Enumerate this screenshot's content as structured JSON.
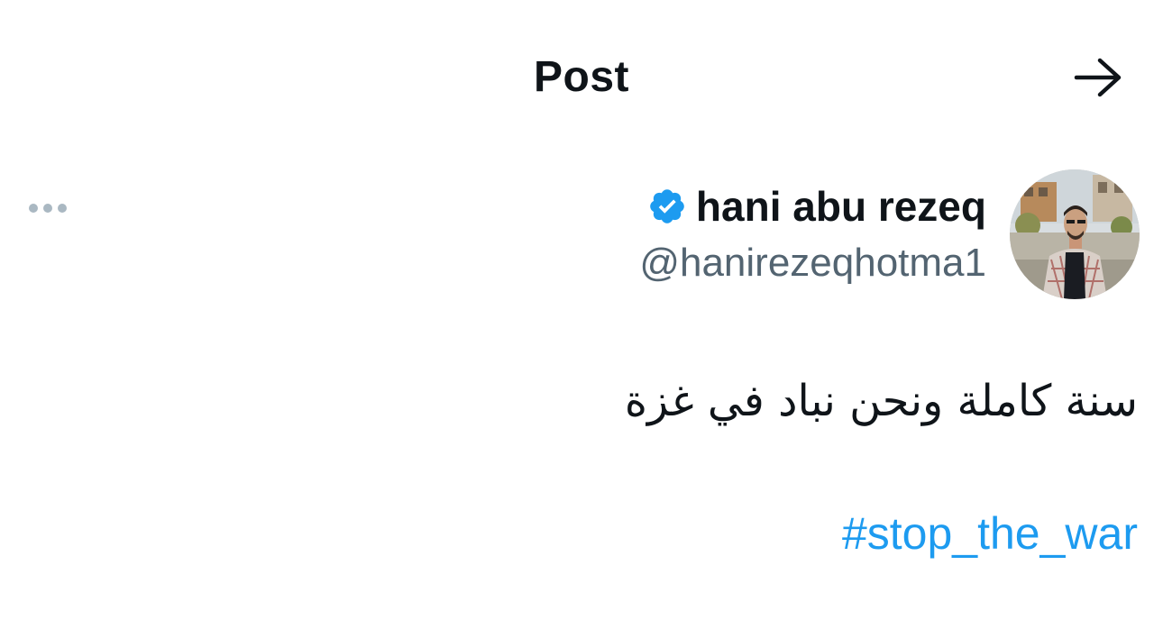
{
  "header": {
    "title": "Post",
    "back_icon": "arrow-right-icon"
  },
  "author": {
    "display_name": "hani abu rezeq",
    "handle": "@hanirezeqhotma1",
    "verified": true,
    "verified_icon": "verified-badge-icon",
    "verified_color": "#1d9bf0"
  },
  "more_icon": "more-options-icon",
  "post": {
    "text": "سنة كاملة ونحن نباد في غزة",
    "hashtag": "#stop_the_war"
  },
  "colors": {
    "text": "#0f1419",
    "secondary": "#536471",
    "accent": "#1d9bf0",
    "background": "#ffffff"
  }
}
